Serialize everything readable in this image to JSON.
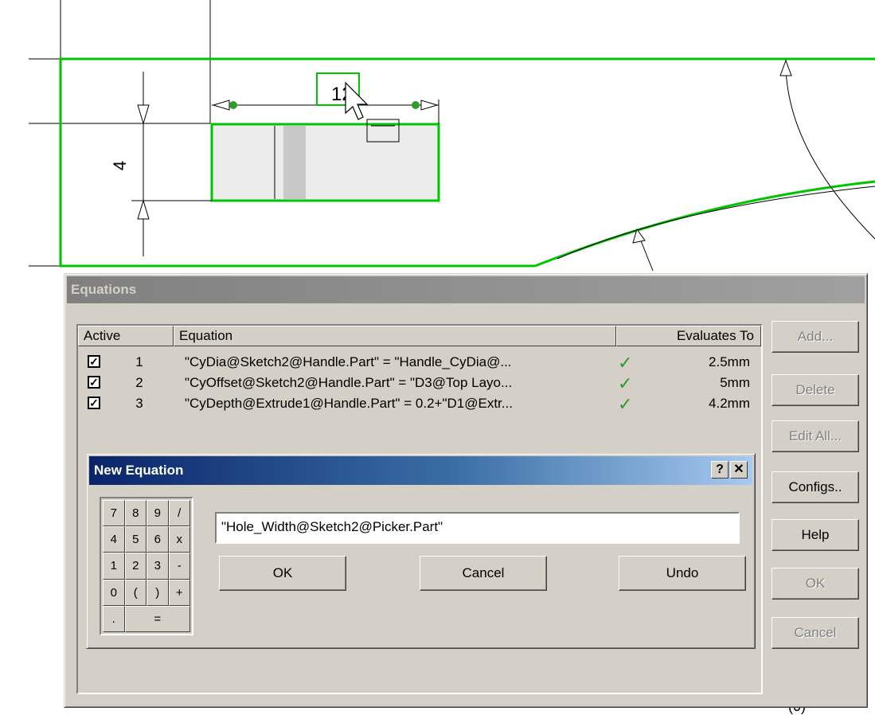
{
  "sketch": {
    "width_dim": "12",
    "height_dim": "4",
    "green": "#00c400"
  },
  "equations_dialog": {
    "title": "Equations",
    "columns": {
      "active": "Active",
      "equation": "Equation",
      "evaluates_to": "Evaluates To"
    },
    "rows": [
      {
        "active": true,
        "num": "1",
        "equation": "\"CyDia@Sketch2@Handle.Part\" = \"Handle_CyDia@...",
        "status_icon": "green-check",
        "value": "2.5mm"
      },
      {
        "active": true,
        "num": "2",
        "equation": "\"CyOffset@Sketch2@Handle.Part\" = \"D3@Top Layo...",
        "status_icon": "green-check",
        "value": "5mm"
      },
      {
        "active": true,
        "num": "3",
        "equation": "\"CyDepth@Extrude1@Handle.Part\" = 0.2+\"D1@Extr...",
        "status_icon": "green-check",
        "value": "4.2mm"
      }
    ],
    "buttons": {
      "add": "Add...",
      "delete": "Delete",
      "edit_all": "Edit All...",
      "configs": "Configs..",
      "help": "Help",
      "ok": "OK",
      "cancel": "Cancel"
    }
  },
  "new_equation": {
    "title": "New Equation",
    "help_btn": "?",
    "close_btn": "✕",
    "keypad": [
      "7",
      "8",
      "9",
      "/",
      "4",
      "5",
      "6",
      "x",
      "1",
      "2",
      "3",
      "-",
      "0",
      "(",
      ")",
      "+",
      ".",
      "="
    ],
    "input_value": "\"Hole_Width@Sketch2@Picker.Part\"",
    "buttons": {
      "ok": "OK",
      "cancel": "Cancel",
      "undo": "Undo"
    }
  }
}
